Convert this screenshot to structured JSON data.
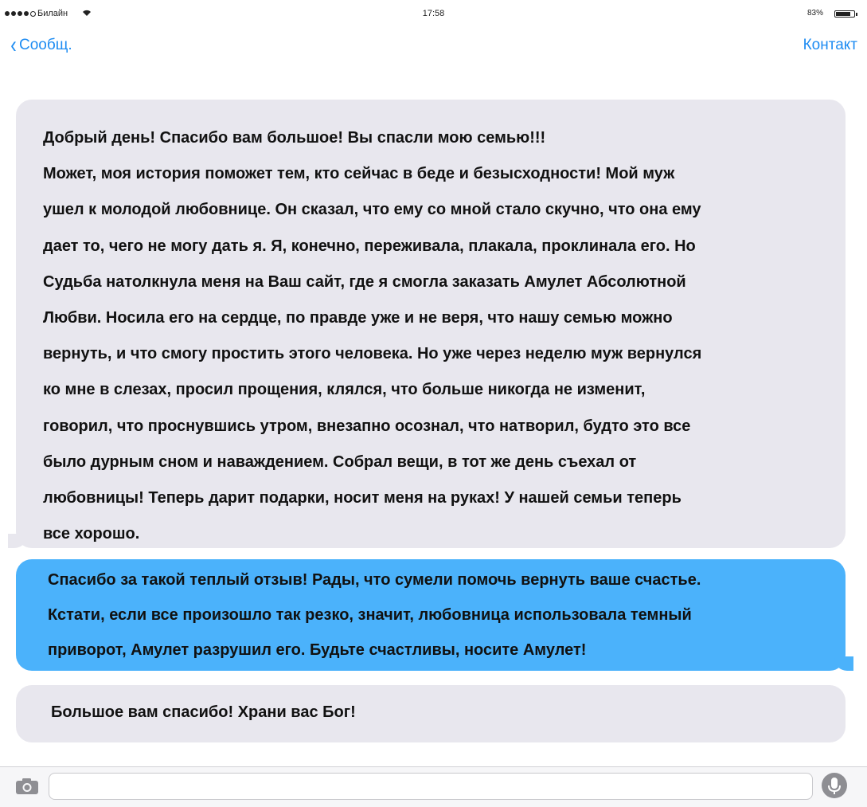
{
  "status_bar": {
    "carrier": "Билайн",
    "time": "17:58",
    "battery": "83%",
    "battery_level": 0.83
  },
  "nav": {
    "back_label": "Сообщ.",
    "contact_label": "Контакт",
    "accent_color": "#1e8cf2"
  },
  "messages": [
    {
      "direction": "incoming",
      "lines": [
        "Добрый день! Спасибо вам большое! Вы спасли мою семью!!!",
        "Может, моя история поможет тем, кто сейчас в беде и безысходности! Мой муж",
        "ушел к молодой любовнице. Он сказал, что ему со мной стало скучно, что она ему",
        "дает то, чего не могу дать я. Я, конечно, переживала, плакала, проклинала его. Но",
        "Судьба натолкнула меня на Ваш сайт, где я смогла заказать  Амулет Абсолютной",
        "Любви. Носила его на сердце, по правде уже и не веря, что нашу семью можно",
        "вернуть, и что смогу простить этого человека. Но уже через неделю муж вернулся",
        "ко мне в слезах, просил прощения, клялся, что больше никогда не изменит,",
        "говорил, что проснувшись утром, внезапно осознал, что натворил, будто это все",
        "было дурным сном и наваждением. Собрал вещи, в тот же день съехал от",
        "любовницы! Теперь дарит подарки,  носит меня на руках! У нашей семьи теперь",
        "все хорошо."
      ]
    },
    {
      "direction": "outgoing",
      "lines": [
        "Спасибо за такой теплый отзыв! Рады, что сумели помочь вернуть ваше счастье.",
        "Кстати, если все произошло так резко, значит, любовница использовала темный",
        "приворот, Амулет разрушил его. Будьте счастливы, носите Амулет!"
      ]
    },
    {
      "direction": "incoming",
      "lines": [
        "Большое вам спасибо! Храни вас Бог!"
      ]
    }
  ],
  "colors": {
    "incoming_bubble": "#e8e7ee",
    "outgoing_bubble": "#4bb2fb"
  },
  "input_bar": {
    "text": "",
    "camera_icon": "camera-icon",
    "mic_icon": "microphone-icon"
  }
}
